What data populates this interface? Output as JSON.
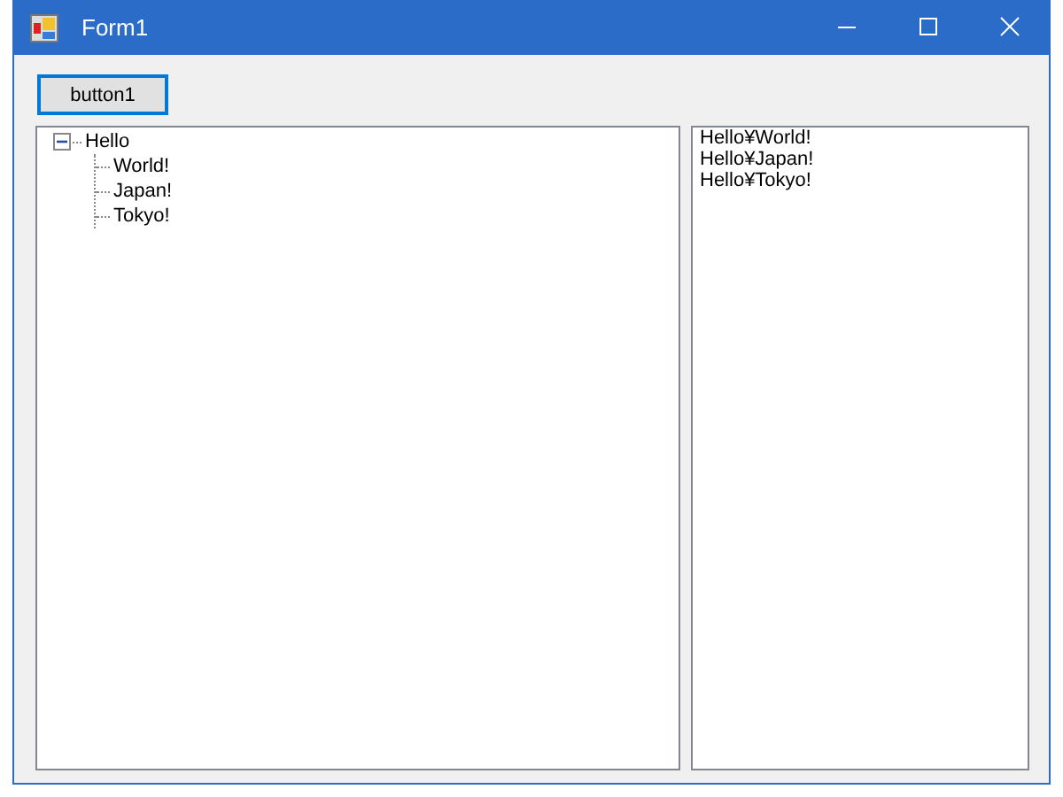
{
  "window": {
    "title": "Form1"
  },
  "button": {
    "label": "button1",
    "focused": true
  },
  "tree": [
    {
      "label": "Hello",
      "expanded": true,
      "children": [
        {
          "label": "World!"
        },
        {
          "label": "Japan!"
        },
        {
          "label": "Tokyo!"
        }
      ]
    }
  ],
  "list": [
    "Hello¥World!",
    "Hello¥Japan!",
    "Hello¥Tokyo!"
  ]
}
